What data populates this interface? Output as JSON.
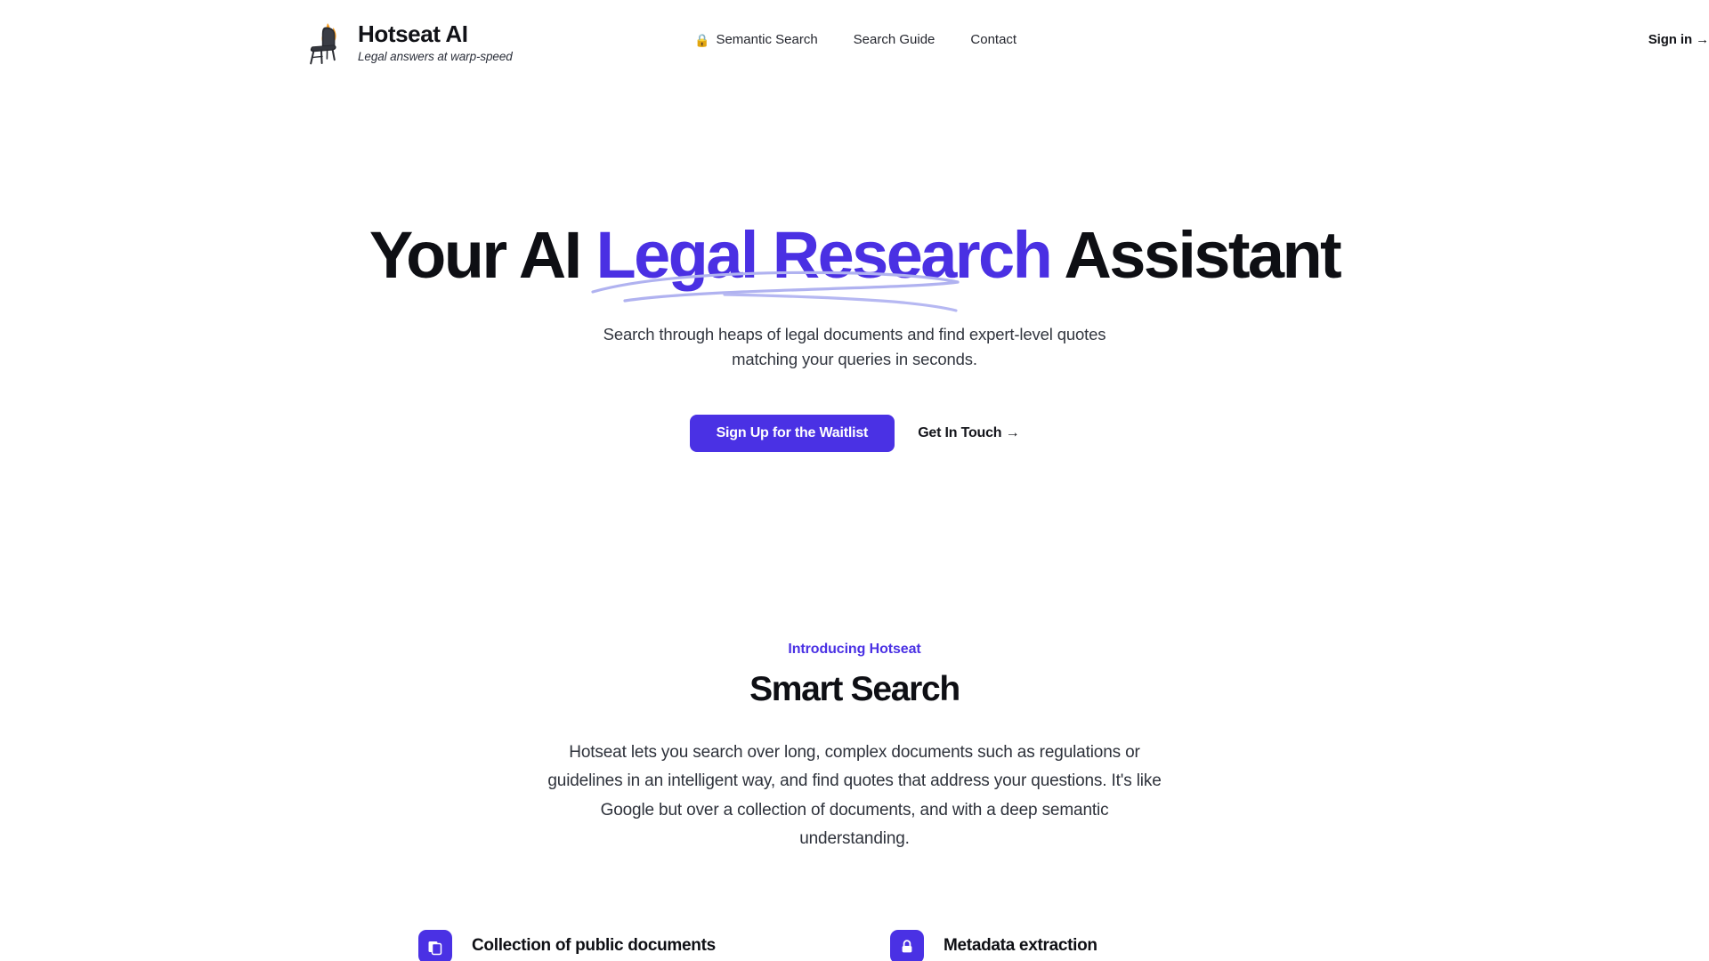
{
  "brand": {
    "name": "Hotseat AI",
    "tagline": "Legal answers at warp-speed",
    "logo_icon": "chair-on-fire-icon"
  },
  "nav": {
    "items": [
      {
        "label": "Semantic Search",
        "emoji": "🔒",
        "icon": "lock-icon",
        "name": "nav-semantic-search"
      },
      {
        "label": "Search Guide",
        "emoji": "",
        "icon": "",
        "name": "nav-search-guide"
      },
      {
        "label": "Contact",
        "emoji": "",
        "icon": "",
        "name": "nav-contact"
      }
    ],
    "signin_label": "Sign in →"
  },
  "hero": {
    "title_part1": "Your AI ",
    "title_highlight": "Legal Research",
    "title_part2": " Assistant",
    "subtitle": "Search through heaps of legal documents and find expert-level quotes matching your queries in seconds.",
    "primary_cta": "Sign Up for the Waitlist",
    "secondary_cta": "Get In Touch →"
  },
  "feature_section": {
    "eyebrow": "Introducing Hotseat",
    "title": "Smart Search",
    "body": "Hotseat lets you search over long, complex documents such as regulations or guidelines in an intelligent way, and find quotes that address your questions. It's like Google but over a collection of documents, and with a deep semantic understanding.",
    "items": [
      {
        "label": "Collection of public documents",
        "icon": "documents-icon"
      },
      {
        "label": "Metadata extraction",
        "icon": "lock-badge-icon"
      }
    ]
  },
  "colors": {
    "accent": "#4a31e4",
    "accent_highlight": "#4a30e3",
    "swoosh": "#aeb0ee",
    "text_primary": "#0e0f14",
    "text_body": "#2e323b",
    "background": "#ffffff"
  }
}
